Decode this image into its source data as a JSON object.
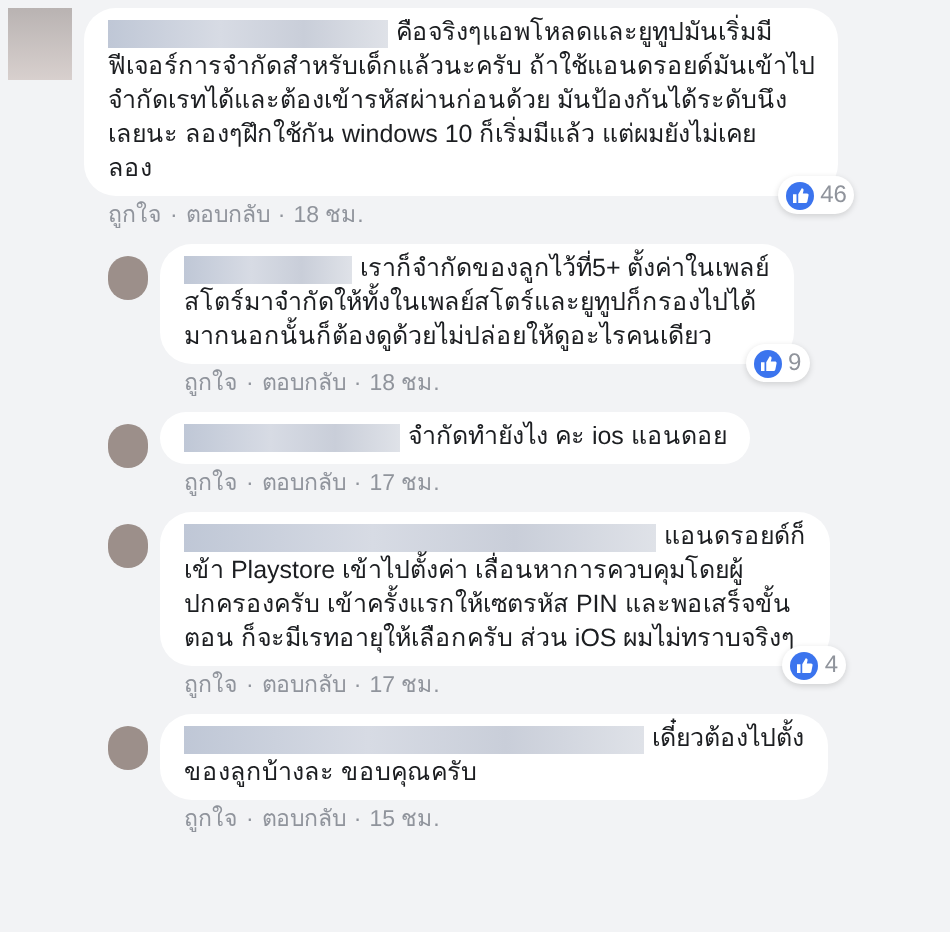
{
  "separator": "·",
  "comments": [
    {
      "kind": "top",
      "lines": [
        "คือจริงๆแอพโหลดและยูทูปมันเริ่มมี",
        "ฟีเจอร์การจำกัดสำหรับเด็กแล้วนะครับ ถ้าใช้แอนดรอยด์มันเข้าไป",
        "จำกัดเรทได้และต้องเข้ารหัสผ่านก่อนด้วย มันป้องกันได้ระดับนึง",
        "เลยนะ ลองๆฝึกใช้กัน windows 10 ก็เริ่มมีแล้ว แต่ผมยังไม่เคย",
        "ลอง"
      ],
      "likes": "46",
      "actions": [
        "ถูกใจ",
        "ตอบกลับ"
      ],
      "time": "18 ชม."
    },
    {
      "kind": "reply",
      "lines": [
        "เราก็จำกัดของลูกไว้ที่5+ ตั้งค่าในเพลย์",
        "สโตร์มาจำกัดให้ทั้งในเพลย์สโตร์และยูทูปก็กรองไปได้",
        "มากนอกนั้นก็ต้องดูด้วยไม่ปล่อยให้ดูอะไรคนเดียว"
      ],
      "likes": "9",
      "actions": [
        "ถูกใจ",
        "ตอบกลับ"
      ],
      "time": "18 ชม."
    },
    {
      "kind": "reply",
      "lines": [
        "จำกัดทำยังไง คะ ios แอนดอย"
      ],
      "actions": [
        "ถูกใจ",
        "ตอบกลับ"
      ],
      "time": "17 ชม."
    },
    {
      "kind": "reply",
      "lines": [
        "แอนดรอยด์ก็",
        "เข้า Playstore เข้าไปตั้งค่า เลื่อนหาการควบคุมโดยผู้",
        "ปกครองครับ เข้าครั้งแรกให้เซตรหัส PIN และพอเสร็จขั้น",
        "ตอน ก็จะมีเรทอายุให้เลือกครับ ส่วน iOS ผมไม่ทราบจริงๆ"
      ],
      "likes": "4",
      "actions": [
        "ถูกใจ",
        "ตอบกลับ"
      ],
      "time": "17 ชม."
    },
    {
      "kind": "reply",
      "lines": [
        "เดี๋ยวต้องไปตั้ง",
        "ของลูกบ้างละ ขอบคุณครับ"
      ],
      "actions": [
        "ถูกใจ",
        "ตอบกลับ"
      ],
      "time": "15 ชม."
    }
  ]
}
